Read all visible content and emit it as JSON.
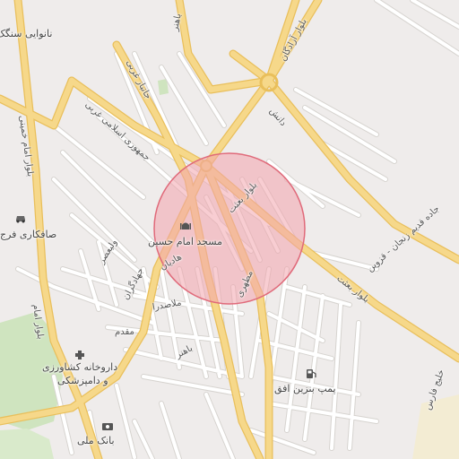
{
  "colors": {
    "background": "#efeceb",
    "major_road": "#f6d88a",
    "major_road_casing": "#e9bf5b",
    "minor_road": "#ffffff",
    "minor_road_casing": "#d6d3cf",
    "park": "#cfe4bf",
    "highlight_fill": "#f2a4ad",
    "highlight_stroke": "#e06a7a",
    "label": "#555555"
  },
  "highlight": {
    "shape": "circle",
    "fill_opacity": 0.55
  },
  "pois": {
    "bakery": {
      "label": "نانوایی سنگک",
      "icon": "bakery-icon"
    },
    "car_shop": {
      "label": "صافکاری فرج",
      "icon": "car-icon"
    },
    "mosque": {
      "label": "مسجد امام حسین",
      "icon": "mosque-icon"
    },
    "vet_pharmacy_1": {
      "label": "داروخانه کشاورزی",
      "icon": "pharmacy-icon"
    },
    "vet_pharmacy_2": {
      "label": "و دامپزشکی"
    },
    "gas_station": {
      "label": "پمپ بنزین افق",
      "icon": "fuel-icon"
    },
    "bank": {
      "label": "بانک ملی",
      "icon": "bank-icon"
    }
  },
  "streets": {
    "bahonar": "باهنر",
    "azadegan": "بلوار آزادگان",
    "danesh": "دانش",
    "jomhouri": "جمهوری اسلامی غربی",
    "jahanbaz": "جانباز غربی",
    "besat_1": "بلوار بعثت",
    "besat_2": "بلوار بعثت",
    "zanjan_qazvin": "جاده قدیم زنجان - قزوین",
    "imam_khomeini_1": "بلوار امام خمینی",
    "imam_khomeini_2": "بلوار امام",
    "valiasr": "ولیعصر",
    "jahadan": "جهادگران",
    "hadi": "هادیان",
    "sadra": "ملاصدرا",
    "moqadam": "مقدم",
    "bahonar_2": "باهنر",
    "motahari": "مطهری",
    "khalij_fars": "خلیج فارس"
  }
}
